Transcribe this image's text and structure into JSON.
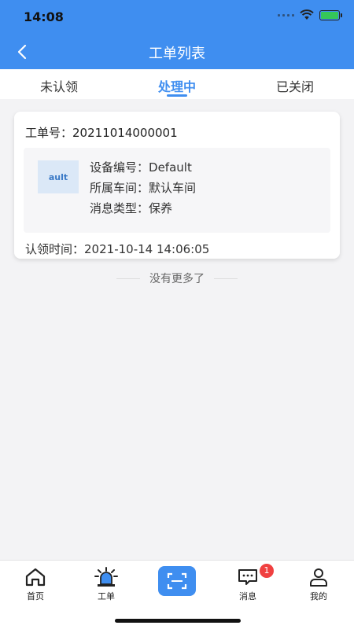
{
  "status": {
    "time": "14:08"
  },
  "header": {
    "title": "工单列表"
  },
  "tabs": [
    {
      "label": "未认领",
      "active": false
    },
    {
      "label": "处理中",
      "active": true
    },
    {
      "label": "已关闭",
      "active": false
    }
  ],
  "order": {
    "number_label": "工单号：",
    "number": "20211014000001",
    "thumb_text": "ault",
    "device_label": "设备编号：",
    "device": "Default",
    "workshop_label": "所属车间：",
    "workshop": "默认车间",
    "type_label": "消息类型：",
    "type": "保养",
    "claim_label": "认领时间：",
    "claim_time": "2021-10-14 14:06:05"
  },
  "list_footer": "没有更多了",
  "tabbar": {
    "home": "首页",
    "workorder": "工单",
    "messages": "消息",
    "messages_badge": "1",
    "mine": "我的"
  },
  "colors": {
    "primary": "#3f8ef0",
    "badge": "#f04040"
  }
}
